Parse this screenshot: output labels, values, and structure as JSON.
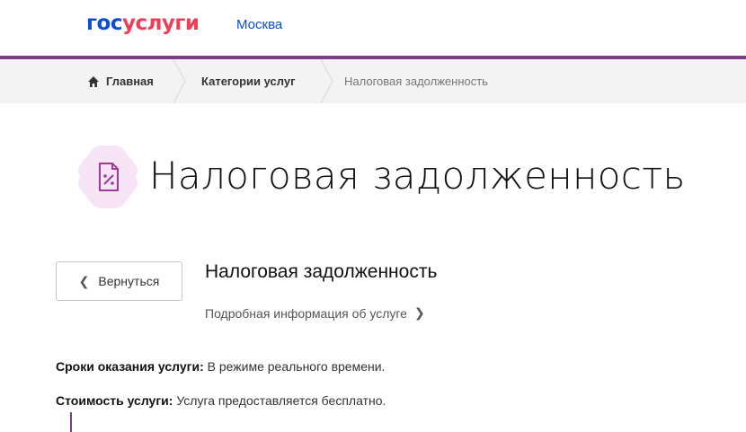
{
  "header": {
    "logo_part1": "гос",
    "logo_part2": "услуги",
    "city": "Москва",
    "accent_color": "#7d3e86"
  },
  "breadcrumb": {
    "home": "Главная",
    "categories": "Категории услуг",
    "current": "Налоговая задолженность"
  },
  "page": {
    "title": "Налоговая задолженность",
    "icon": "tax-document-icon"
  },
  "service": {
    "back_label": "Вернуться",
    "title": "Налоговая задолженность",
    "details_link": "Подробная информация об услуге"
  },
  "info": {
    "term_label": "Сроки оказания услуги:",
    "term_value": "В режиме реального времени.",
    "cost_label": "Стоимость услуги:",
    "cost_value": "Услуга предоставляется бесплатно."
  }
}
